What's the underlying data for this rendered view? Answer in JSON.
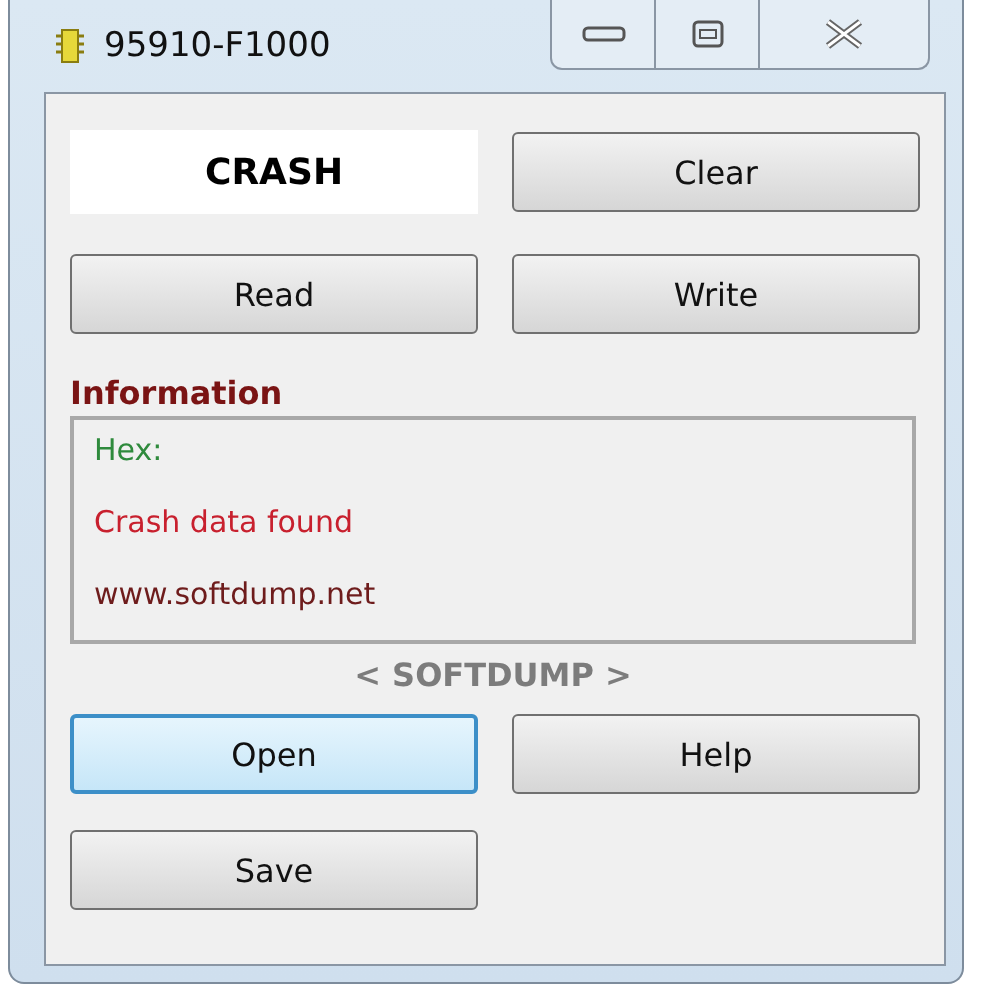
{
  "window": {
    "title": "95910-F1000"
  },
  "display": {
    "value": "CRASH"
  },
  "top_buttons": [
    {
      "label": "Clear",
      "focused": false
    },
    {
      "label": "Read",
      "focused": false
    },
    {
      "label": "Write",
      "focused": false
    }
  ],
  "information": {
    "heading": "Information",
    "lines": [
      {
        "text": "Hex:",
        "color": "#2e8a3c"
      },
      {
        "text": "Crash data found",
        "color": "#c8202e"
      },
      {
        "text": "www.softdump.net",
        "color": "#6e1c1c"
      }
    ]
  },
  "brand": "< SOFTDUMP >",
  "bottom_buttons": [
    {
      "label": "Open",
      "focused": true
    },
    {
      "label": "Help",
      "focused": false
    },
    {
      "label": "Save",
      "focused": false
    }
  ]
}
